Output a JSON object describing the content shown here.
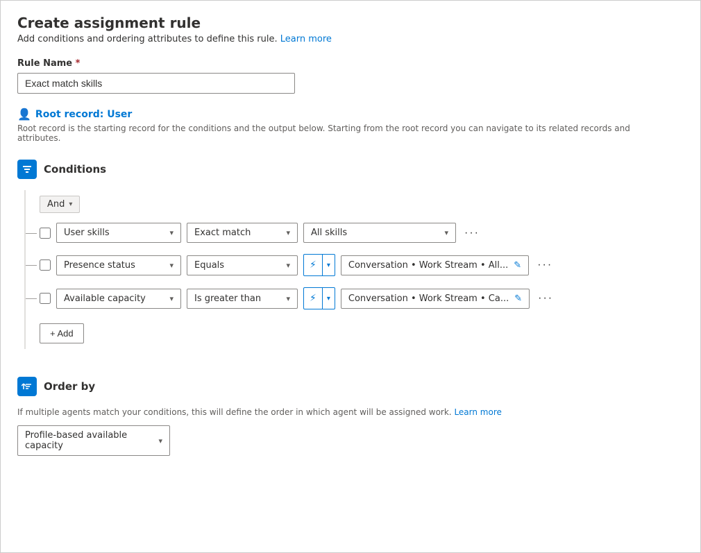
{
  "page": {
    "title": "Create assignment rule",
    "subtitle": "Add conditions and ordering attributes to define this rule.",
    "learn_more_label": "Learn more",
    "rule_name_label": "Rule Name",
    "rule_name_required": "*",
    "rule_name_value": "Exact match skills",
    "root_record_label": "Root record: User",
    "root_record_desc": "Root record is the starting record for the conditions and the output below. Starting from the root record you can navigate to its related records and attributes."
  },
  "conditions": {
    "section_title": "Conditions",
    "and_label": "And",
    "rows": [
      {
        "id": "row1",
        "field": "User skills",
        "operator": "Exact match",
        "value": "All skills"
      },
      {
        "id": "row2",
        "field": "Presence status",
        "operator": "Equals",
        "value": "Conversation • Work Stream • All..."
      },
      {
        "id": "row3",
        "field": "Available capacity",
        "operator": "Is greater than",
        "value": "Conversation • Work Stream • Ca..."
      }
    ],
    "add_label": "+ Add"
  },
  "order_by": {
    "section_title": "Order by",
    "desc": "If multiple agents match your conditions, this will define the order in which agent will be assigned work.",
    "learn_more_label": "Learn more",
    "value": "Profile-based available capacity"
  }
}
